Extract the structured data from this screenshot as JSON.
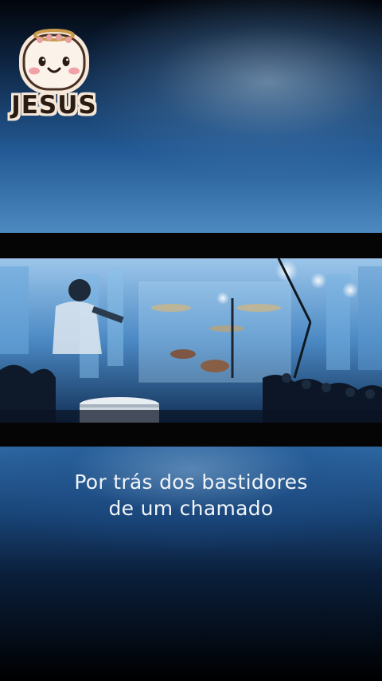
{
  "logo": {
    "text": "JESUS",
    "icon": "smiling-angel-face-icon"
  },
  "caption": {
    "line1": "Por trás dos bastidores",
    "line2": "de um chamado"
  },
  "colors": {
    "background_blue": "#235a95",
    "letterbox": "#050505",
    "caption_text": "#f2f5f8",
    "logo_text": "#2a1c12",
    "logo_outline": "#f6e8d8"
  }
}
